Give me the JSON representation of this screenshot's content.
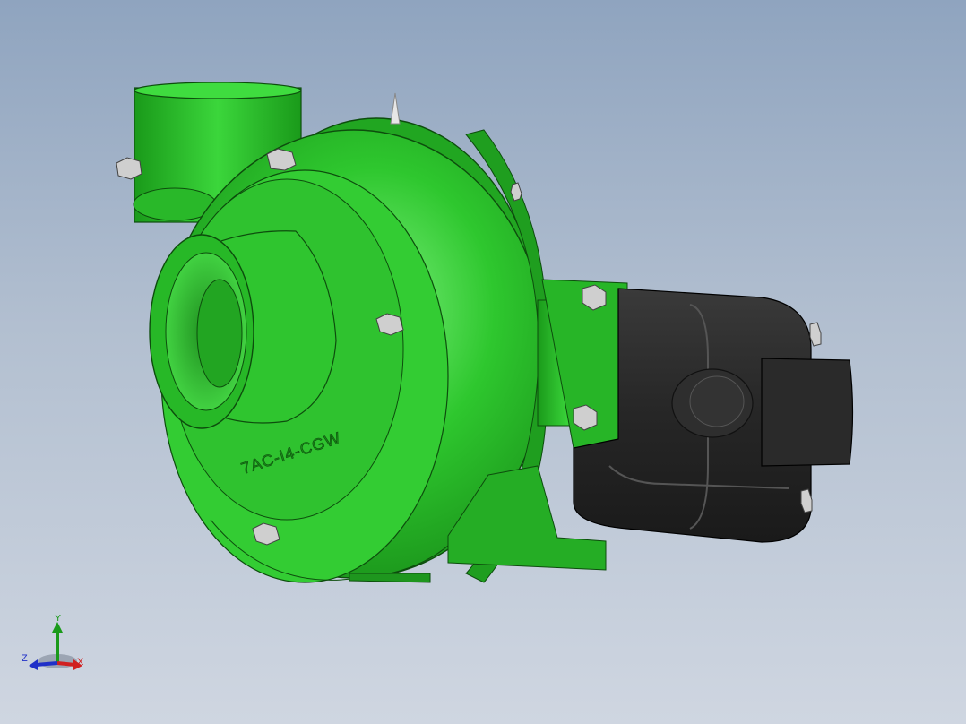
{
  "viewport": {
    "model_name": "centrifugal-pump-with-hydraulic-motor",
    "colors": {
      "background_top": "#8fa4bf",
      "background_bottom": "#cfd6e1",
      "pump_body": "#2ec72e",
      "pump_shadow": "#1a8f1a",
      "pump_highlight": "#7cf07c",
      "motor_body": "#2b2b2b",
      "motor_highlight": "#555555",
      "bolt": "#c9c9c9"
    }
  },
  "model": {
    "embossed_text": "7AC-I4-CGW"
  },
  "triad": {
    "x_label": "X",
    "y_label": "Y",
    "z_label": "Z",
    "x_color": "#d02020",
    "y_color": "#1a9a1a",
    "z_color": "#2030c8"
  }
}
